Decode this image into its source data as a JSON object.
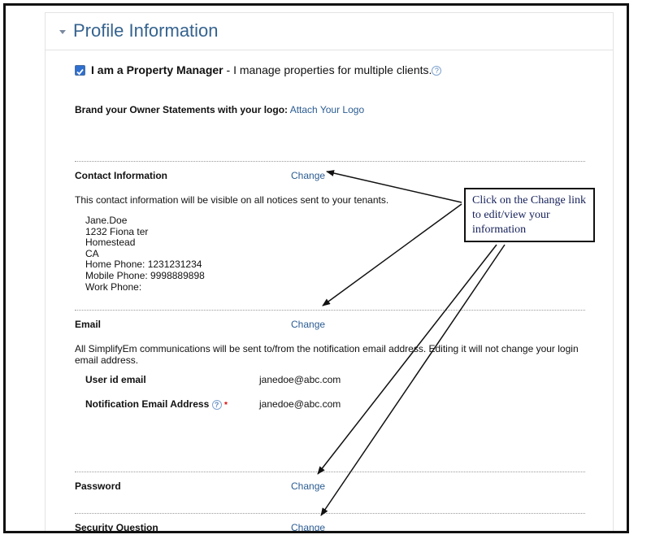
{
  "panel": {
    "title": "Profile Information",
    "collapse_icon": "triangle-down-icon"
  },
  "property_manager": {
    "checked": true,
    "label_bold": "I am a Property Manager",
    "label_rest": " - I manage properties for multiple clients.",
    "help_icon": "?"
  },
  "branding": {
    "label": "Brand your Owner Statements with your logo:",
    "link": "Attach Your Logo"
  },
  "contact": {
    "label": "Contact Information",
    "change": "Change",
    "note": "This contact information will be visible on all notices sent to your tenants.",
    "lines": [
      "Jane.Doe",
      "1232 Fiona ter",
      "Homestead",
      "CA",
      "Home Phone: 1231231234",
      "Mobile Phone: 9998889898",
      "Work Phone:"
    ]
  },
  "email": {
    "label": "Email",
    "change": "Change",
    "note": "All SimplifyEm communications will be sent to/from the notification email address. Editing it will not change your login email address.",
    "user_id_label": "User id email",
    "user_id_value": "janedoe@abc.com",
    "notification_label": "Notification Email Address",
    "help_icon": "?",
    "required_marker": "*",
    "notification_value": "janedoe@abc.com"
  },
  "password": {
    "label": "Password",
    "change": "Change"
  },
  "security": {
    "label": "Security Question",
    "change": "Change"
  },
  "callout": {
    "text": "Click on the Change link to edit/view your information"
  }
}
